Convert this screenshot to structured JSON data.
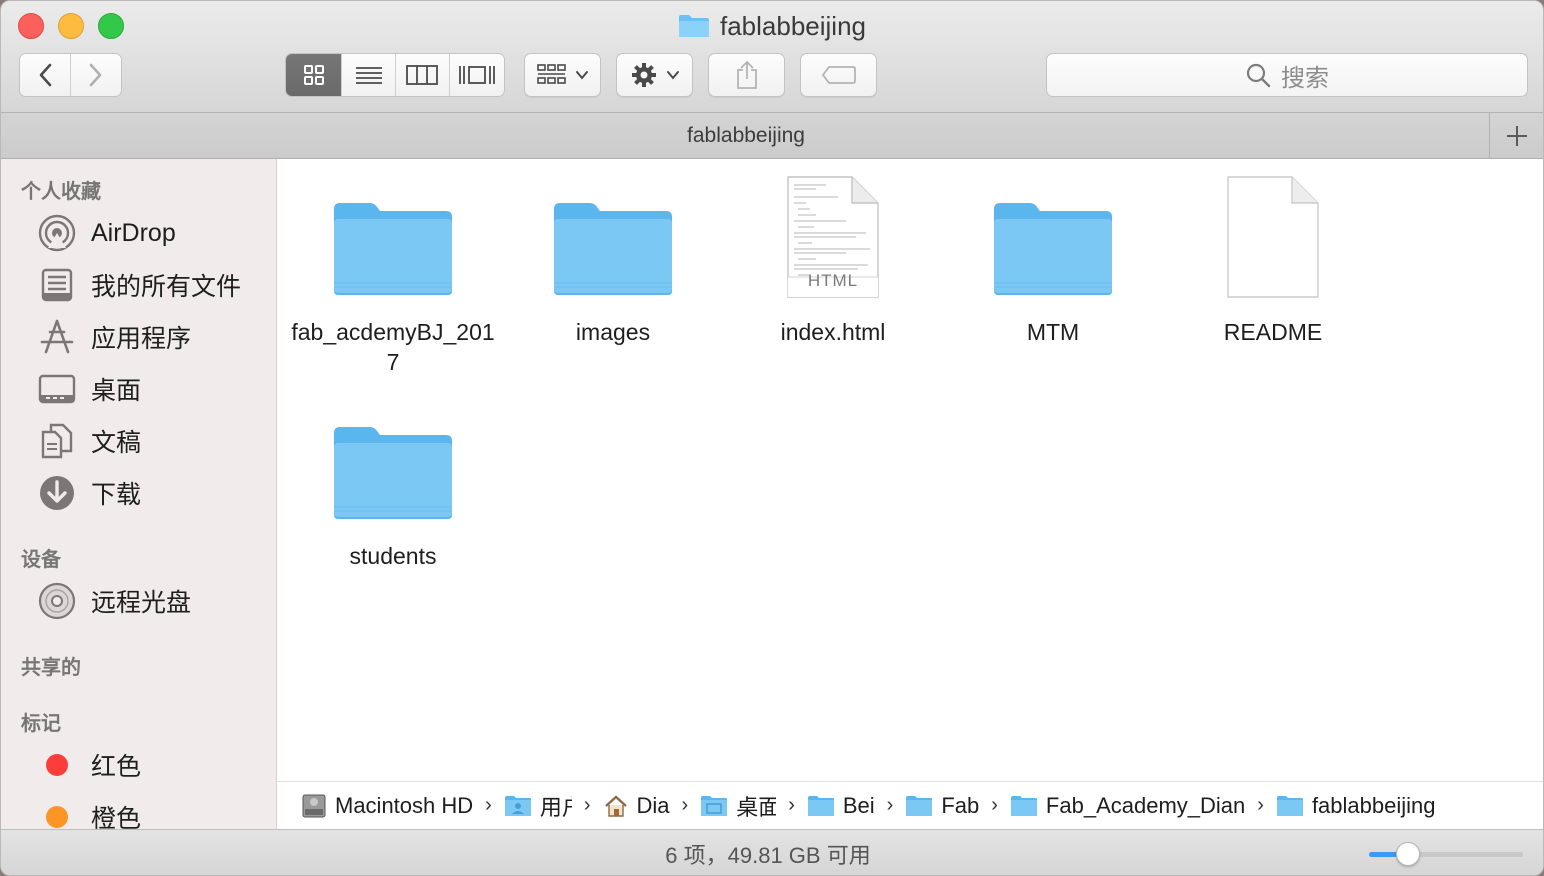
{
  "window": {
    "title": "fablabbeijing",
    "tab_title": "fablabbeijing"
  },
  "toolbar": {
    "search_placeholder": "搜索",
    "view_modes": [
      "icon-view",
      "list-view",
      "column-view",
      "cover-flow-view"
    ],
    "active_view": "icon-view"
  },
  "sidebar": {
    "favorites_header": "个人收藏",
    "favorites": [
      {
        "label": "AirDrop",
        "icon": "airdrop-icon"
      },
      {
        "label": "我的所有文件",
        "icon": "all-files-icon"
      },
      {
        "label": "应用程序",
        "icon": "applications-icon"
      },
      {
        "label": "桌面",
        "icon": "desktop-icon"
      },
      {
        "label": "文稿",
        "icon": "documents-icon"
      },
      {
        "label": "下载",
        "icon": "downloads-icon"
      }
    ],
    "devices_header": "设备",
    "devices": [
      {
        "label": "远程光盘",
        "icon": "remote-disc-icon"
      }
    ],
    "shared_header": "共享的",
    "tags_header": "标记",
    "tags": [
      {
        "label": "红色",
        "color": "#fc3d39"
      },
      {
        "label": "橙色",
        "color": "#fd9426"
      }
    ]
  },
  "files": [
    {
      "name": "fab_acdemyBJ_2017",
      "kind": "folder"
    },
    {
      "name": "images",
      "kind": "folder"
    },
    {
      "name": "index.html",
      "kind": "html",
      "badge": "HTML"
    },
    {
      "name": "MTM",
      "kind": "folder"
    },
    {
      "name": "README",
      "kind": "document"
    },
    {
      "name": "students",
      "kind": "folder"
    }
  ],
  "pathbar": [
    {
      "label": "Macintosh HD",
      "icon": "hard-drive-icon"
    },
    {
      "label": "用户",
      "icon": "folder-icon"
    },
    {
      "label": "Dia",
      "icon": "home-icon"
    },
    {
      "label": "桌面",
      "icon": "folder-icon"
    },
    {
      "label": "Bei",
      "icon": "folder-icon"
    },
    {
      "label": "Fab",
      "icon": "folder-icon"
    },
    {
      "label": "Fab_Academy_Dian",
      "icon": "folder-icon"
    },
    {
      "label": "fablabbeijing",
      "icon": "folder-icon"
    }
  ],
  "status": {
    "text": "6 项，49.81 GB 可用",
    "icon_size": 0.25
  },
  "colors": {
    "folder": "#7cc8f5",
    "accent": "#3b99fc"
  }
}
